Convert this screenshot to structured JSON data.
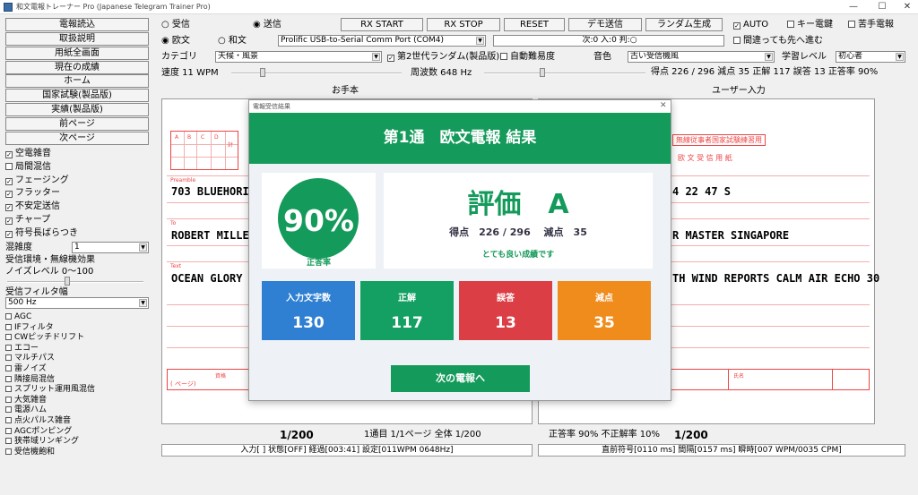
{
  "window": {
    "title": "和文電報トレーナー Pro (Japanese Telegram Trainer Pro)",
    "controls": [
      "—",
      "☐",
      "✕"
    ]
  },
  "sidebar": {
    "buttons": [
      "電報読込",
      "取扱説明",
      "用紙全画面",
      "現在の成績",
      "ホーム",
      "国家試験(製品版)",
      "実績(製品版)",
      "前ページ",
      "次ページ"
    ],
    "effects": [
      {
        "label": "空電雑音",
        "checked": true
      },
      {
        "label": "局間混信",
        "checked": false
      },
      {
        "label": "フェージング",
        "checked": true
      },
      {
        "label": "フラッター",
        "checked": true
      },
      {
        "label": "不安定送信",
        "checked": true
      },
      {
        "label": "チャープ",
        "checked": true
      },
      {
        "label": "符号長ばらつき",
        "checked": true
      }
    ],
    "mix_label": "混雑度",
    "mix_value": "1",
    "env_label": "受信環境・無線機効果",
    "noise_label": "ノイズレベル 0～100",
    "filter_label": "受信フィルタ幅",
    "filter_value": "500 Hz",
    "options": [
      {
        "label": "AGC",
        "checked": false
      },
      {
        "label": "IFフィルタ",
        "checked": false
      },
      {
        "label": "CWピッチドリフト",
        "checked": false
      },
      {
        "label": "エコー",
        "checked": false
      },
      {
        "label": "マルチパス",
        "checked": false
      },
      {
        "label": "雷ノイズ",
        "checked": false
      },
      {
        "label": "隣接局混信",
        "checked": false
      },
      {
        "label": "スプリット運用風混信",
        "checked": false
      },
      {
        "label": "大気雑音",
        "checked": false
      },
      {
        "label": "電源ハム",
        "checked": false
      },
      {
        "label": "点火パルス雑音",
        "checked": false
      },
      {
        "label": "AGCポンピング",
        "checked": false
      },
      {
        "label": "狭帯域リンギング",
        "checked": false
      },
      {
        "label": "受信機飽和",
        "checked": false
      }
    ]
  },
  "topbar": {
    "mode_recv": "受信",
    "mode_send": "送信",
    "mode_selected": "send",
    "lang_eu": "欧文",
    "lang_jp": "和文",
    "lang_selected": "eu",
    "port_value": "Prolific USB-to-Serial Comm Port (COM4)",
    "buttons": [
      "RX START",
      "RX STOP",
      "RESET",
      "デモ送信",
      "ランダム生成"
    ],
    "status": "次:0 入:0 判:○",
    "auto": {
      "label": "AUTO",
      "checked": true
    },
    "key": {
      "label": "キー電鍵",
      "checked": false
    },
    "weak": {
      "label": "苦手電報",
      "checked": false
    },
    "advance": {
      "label": "間違っても先へ進む",
      "checked": false
    },
    "category_label": "カテゴリ",
    "category_value": "天候・風景",
    "gen2": {
      "label": "第2世代ランダム(製品版)",
      "checked": true
    },
    "auto_diff": {
      "label": "自動難易度",
      "checked": false
    },
    "tone_label": "音色",
    "tone_value": "古い受信機風",
    "level_label": "学習レベル",
    "level_value": "初心者",
    "speed_label": "速度 11 WPM",
    "freq_label": "周波数 648 Hz",
    "score_line": "得点 226 / 296  減点 35  正解 117  誤答 13  正答率 90%"
  },
  "left_panel": {
    "header": "お手本",
    "grid_headers": [
      "A",
      "B",
      "C",
      "D",
      "計"
    ],
    "field_preamble": "Preamble",
    "field_to": "To",
    "field_text": "Text",
    "preamble": "703 BLUEHORIZ",
    "to": "ROBERT MILLER",
    "text": "OCEAN GLORY A",
    "seal_label": "資格",
    "page_mark": "( ページ)",
    "footer_count": "1/200",
    "footer_info": "1通目 1/1ページ 全体 1/200",
    "status_bar": "入力[ ] 状態[OFF] 経過[003:41] 設定[011WPM 0648Hz]"
  },
  "right_panel": {
    "header": "ユーザー入力",
    "form_title": "無線従事者国家試験練習用",
    "form_sub": "欧 文 受 信 用 紙",
    "preamble": "4 22 47 S",
    "to": "R MASTER SINGAPORE",
    "text": "TH WIND REPORTS CALM AIR ECHO 30",
    "sign_label": "氏名",
    "footer_score": "正答率 90%  不正解率 10%",
    "footer_count": "1/200",
    "status_bar": "直前符号[0110 ms] 間隔[0157 ms] 瞬時[007 WPM/0035 CPM]"
  },
  "dialog": {
    "window_title": "電報受信結果",
    "close": "✕",
    "header": "第1通　欧文電報 結果",
    "percent": "90%",
    "percent_label": "正答率",
    "grade": "評価　A",
    "score_text": "得点　226 / 296　 減点　35",
    "comment": "とても良い成績です",
    "stats": [
      {
        "label": "入力文字数",
        "value": "130",
        "color": "#2f7fd2"
      },
      {
        "label": "正解",
        "value": "117",
        "color": "#14a062"
      },
      {
        "label": "誤答",
        "value": "13",
        "color": "#db3e45"
      },
      {
        "label": "減点",
        "value": "35",
        "color": "#ef8c1c"
      }
    ],
    "next_button": "次の電報へ",
    "accent": "#149a5a"
  }
}
